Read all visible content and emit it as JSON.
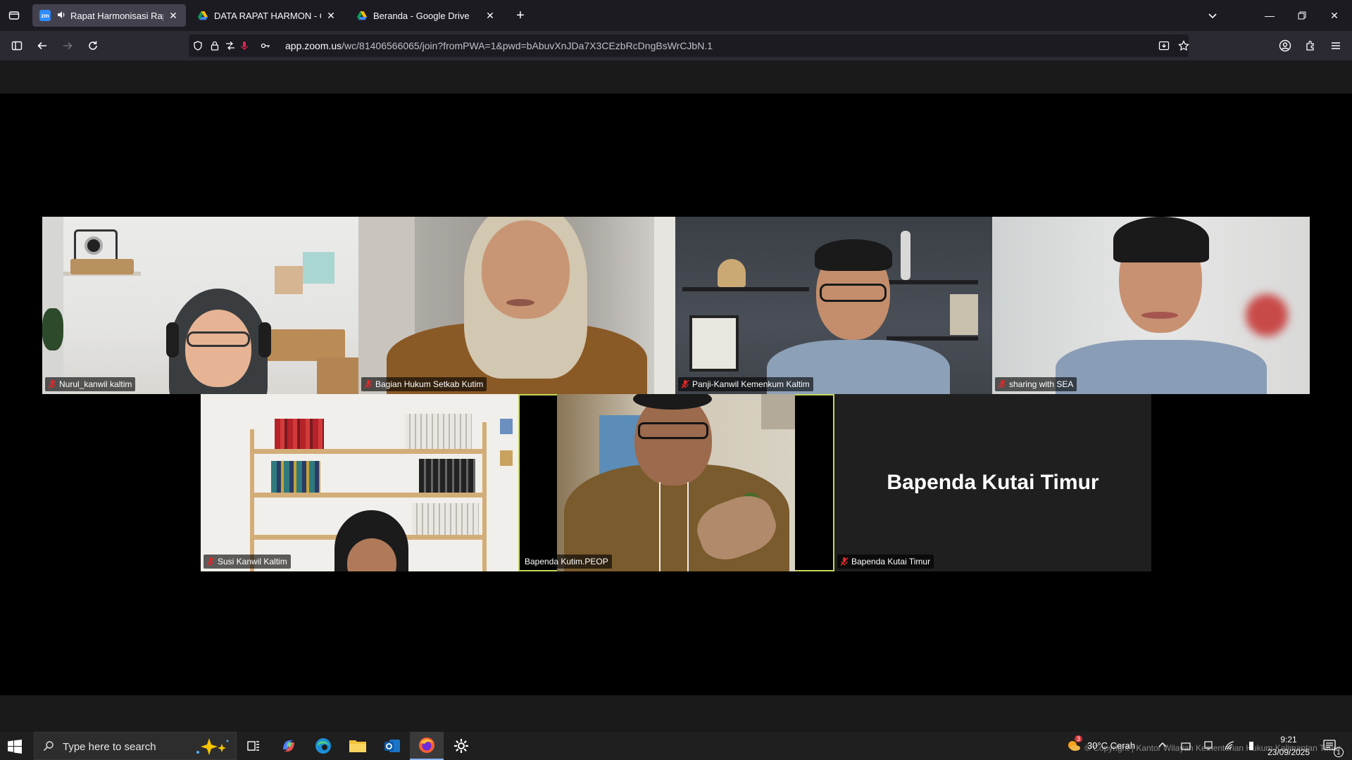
{
  "browser": {
    "tabs": [
      {
        "title": "Rapat Harmonisasi Raperbu",
        "active": true,
        "favicon": "zoom-icon",
        "favicon_text": "zm",
        "audio": true
      },
      {
        "title": "DATA RAPAT HARMON - Googl",
        "active": false,
        "favicon": "google-drive-icon"
      },
      {
        "title": "Beranda - Google Drive",
        "active": false,
        "favicon": "google-drive-icon"
      }
    ],
    "url_host": "app.zoom.us",
    "url_path": "/wc/81406566065/join?fromPWA=1&pwd=bAbuvXnJDa7X3CEzbRcDngBsWrCJbN.1"
  },
  "meeting": {
    "participants": [
      {
        "name": "Nurul_kanwil kaltim",
        "muted": true
      },
      {
        "name": "Bagian Hukum Setkab Kutim",
        "muted": true
      },
      {
        "name": "Panji-Kanwil Kemenkum Kaltim",
        "muted": true
      },
      {
        "name": "sharing with SEA",
        "muted": true
      },
      {
        "name": "Susi Kanwil Kaltim",
        "muted": true
      },
      {
        "name": "Bapenda Kutim.PEOP",
        "muted": false,
        "active_speaker": true
      },
      {
        "name": "Bapenda Kutai Timur",
        "muted": true,
        "video_off": true,
        "display_name": "Bapenda Kutai Timur"
      }
    ],
    "colors": {
      "active_speaker_border": "#c6d65a",
      "mute_icon": "#e02828",
      "tile_bg": "#232323"
    }
  },
  "taskbar": {
    "search_placeholder": "Type here to search",
    "weather_badge": "3",
    "weather": "30°C  Cerah",
    "time": "9:21",
    "date": "23/09/2025",
    "watermark": "© Copyright | Kantor Wilayah Kementerian Hukum Kalimantan Timur",
    "notification_count": "1"
  }
}
